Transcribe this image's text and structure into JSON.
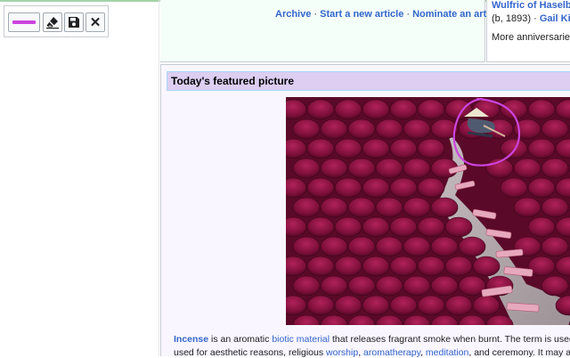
{
  "toolbar": {
    "pen_color": "#cc44dd",
    "icons": [
      "pen-swatch",
      "eraser-icon",
      "save-icon",
      "close-icon"
    ],
    "close_label": "✕"
  },
  "on_this_day": {
    "archive": "Archive",
    "start": "Start a new article",
    "nominate": "Nominate an article",
    "separator": "·"
  },
  "anniversaries": {
    "name": "Wulfric of Haselbur",
    "born_prefix": "(b, 1893) · ",
    "born_link": "Gail Kim",
    "more": "More anniversaries:"
  },
  "featured": {
    "title": "Today's featured picture",
    "caption1": {
      "term": "Incense",
      "t1": " is an aromatic ",
      "link1": "biotic material",
      "t2": " that releases fragrant smoke when burnt. The term is used for e"
    },
    "caption2": {
      "t1": "used for aesthetic reasons, religious ",
      "link1": "worship",
      "t2": ", ",
      "link2": "aromatherapy",
      "t3": ", ",
      "link3": "meditation",
      "t4": ", and ceremony. It may also be"
    }
  },
  "colors": {
    "link": "#3366cc",
    "header_bg": "#ddcef2",
    "panel_bg": "#f9f6ff",
    "annotation": "#cc44dd"
  }
}
